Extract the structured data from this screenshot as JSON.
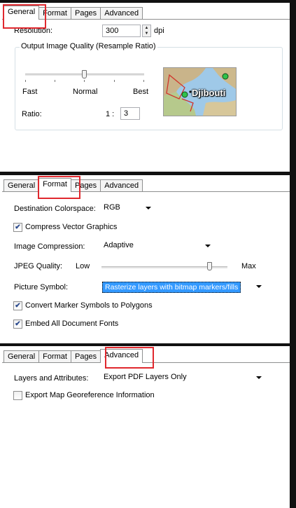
{
  "general": {
    "tabs": [
      "General",
      "Format",
      "Pages",
      "Advanced"
    ],
    "resolution_label": "Resolution:",
    "resolution_value": "300",
    "resolution_unit": "dpi",
    "quality_group_title": "Output Image Quality (Resample Ratio)",
    "quality_fast": "Fast",
    "quality_normal": "Normal",
    "quality_best": "Best",
    "ratio_label": "Ratio:",
    "ratio_prefix": "1 :",
    "ratio_value": "3",
    "preview_label": "Djibouti"
  },
  "format": {
    "tabs": [
      "General",
      "Format",
      "Pages",
      "Advanced"
    ],
    "colorspace_label": "Destination Colorspace:",
    "colorspace_value": "RGB",
    "compress_vector_label": "Compress Vector Graphics",
    "compress_vector_checked": true,
    "image_compression_label": "Image Compression:",
    "image_compression_value": "Adaptive",
    "jpeg_quality_label": "JPEG Quality:",
    "jpeg_low": "Low",
    "jpeg_max": "Max",
    "picture_symbol_label": "Picture Symbol:",
    "picture_symbol_value": "Rasterize layers with bitmap markers/fills",
    "convert_marker_label": "Convert Marker Symbols to Polygons",
    "convert_marker_checked": true,
    "embed_fonts_label": "Embed All Document Fonts",
    "embed_fonts_checked": true
  },
  "advanced": {
    "tabs": [
      "General",
      "Format",
      "Pages",
      "Advanced"
    ],
    "layers_label": "Layers and Attributes:",
    "layers_value": "Export PDF Layers Only",
    "georef_label": "Export Map Georeference Information",
    "georef_checked": false
  },
  "colors": {
    "highlight": "#e0282e",
    "selection": "#3399ff",
    "frame": "#111111"
  },
  "check_glyph": "✔"
}
